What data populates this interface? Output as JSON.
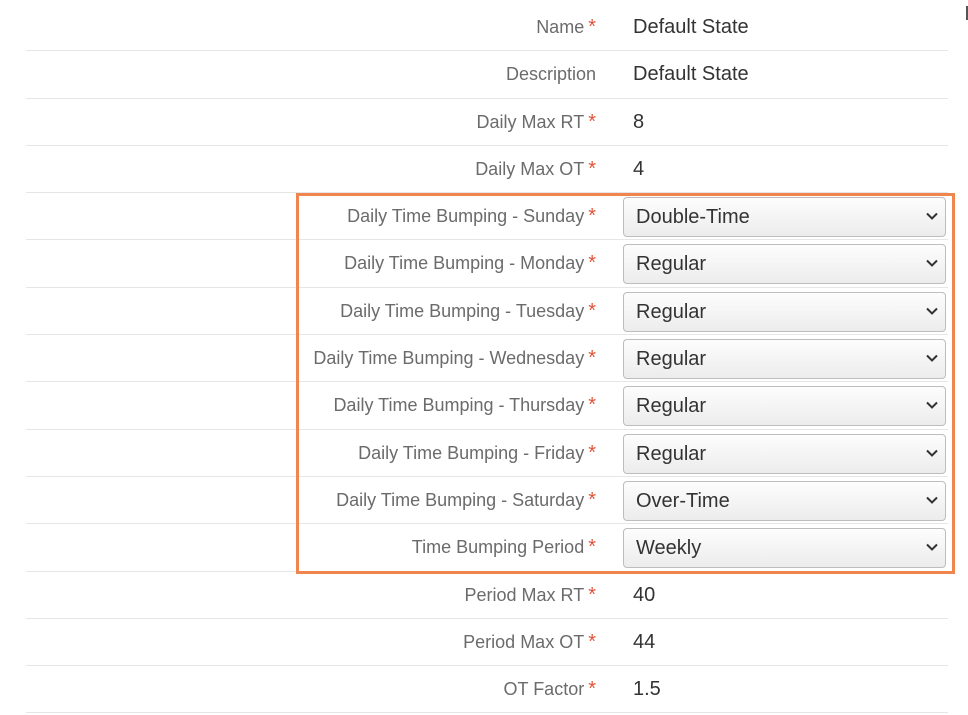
{
  "fields": [
    {
      "label": "Name",
      "value": "Default State",
      "required": true
    },
    {
      "label": "Description",
      "value": "Default State",
      "required": false
    },
    {
      "label": "Daily Max RT",
      "value": "8",
      "required": true
    },
    {
      "label": "Daily Max OT",
      "value": "4",
      "required": true
    },
    {
      "label": "Daily Time Bumping - Sunday",
      "value": "Double-Time",
      "required": true
    },
    {
      "label": "Daily Time Bumping - Monday",
      "value": "Regular",
      "required": true
    },
    {
      "label": "Daily Time Bumping - Tuesday",
      "value": "Regular",
      "required": true
    },
    {
      "label": "Daily Time Bumping - Wednesday",
      "value": "Regular",
      "required": true
    },
    {
      "label": "Daily Time Bumping - Thursday",
      "value": "Regular",
      "required": true
    },
    {
      "label": "Daily Time Bumping - Friday",
      "value": "Regular",
      "required": true
    },
    {
      "label": "Daily Time Bumping - Saturday",
      "value": "Over-Time",
      "required": true
    },
    {
      "label": "Time Bumping Period",
      "value": "Weekly",
      "required": true
    },
    {
      "label": "Period Max RT",
      "value": "40",
      "required": true
    },
    {
      "label": "Period Max OT",
      "value": "44",
      "required": true
    },
    {
      "label": "OT Factor",
      "value": "1.5",
      "required": true
    }
  ],
  "required_mark": "*",
  "colors": {
    "highlight_border": "#f0854d",
    "required_asterisk": "#e0543b",
    "label_text": "#6b6b6b",
    "value_text": "#333333",
    "row_divider": "#e6e6e6"
  },
  "icons": {
    "dropdown": "chevron-down-icon"
  }
}
